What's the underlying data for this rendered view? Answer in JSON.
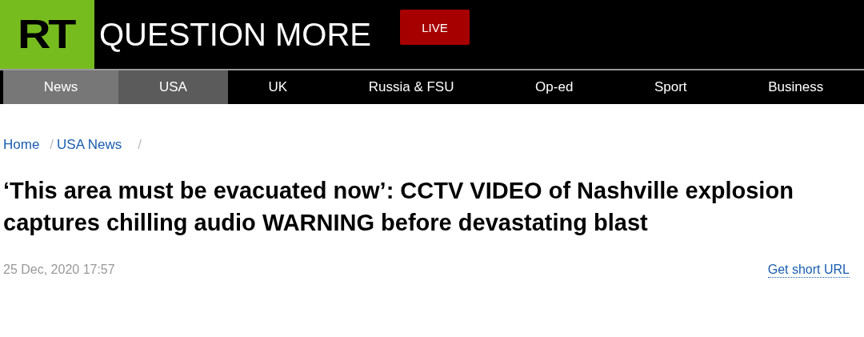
{
  "header": {
    "logo": "RT",
    "tagline": "QUESTION MORE",
    "live_button": "LIVE"
  },
  "nav": [
    {
      "label": "News",
      "selected": false,
      "parent": true
    },
    {
      "label": "USA",
      "selected": true,
      "parent": false
    },
    {
      "label": "UK",
      "selected": false,
      "parent": false
    },
    {
      "label": "Russia & FSU",
      "selected": false,
      "parent": false
    },
    {
      "label": "Op-ed",
      "selected": false,
      "parent": false
    },
    {
      "label": "Sport",
      "selected": false,
      "parent": false
    },
    {
      "label": "Business",
      "selected": false,
      "parent": false
    }
  ],
  "breadcrumbs": [
    {
      "label": "Home"
    },
    {
      "label": "USA News"
    }
  ],
  "breadcrumb_separator": "/",
  "article": {
    "headline": "‘This area must be evacuated now’: CCTV VIDEO of Nashville explosion captures chilling audio WARNING before devastating blast",
    "date": "25 Dec, 2020 17:57",
    "short_url_link": "Get short URL"
  }
}
